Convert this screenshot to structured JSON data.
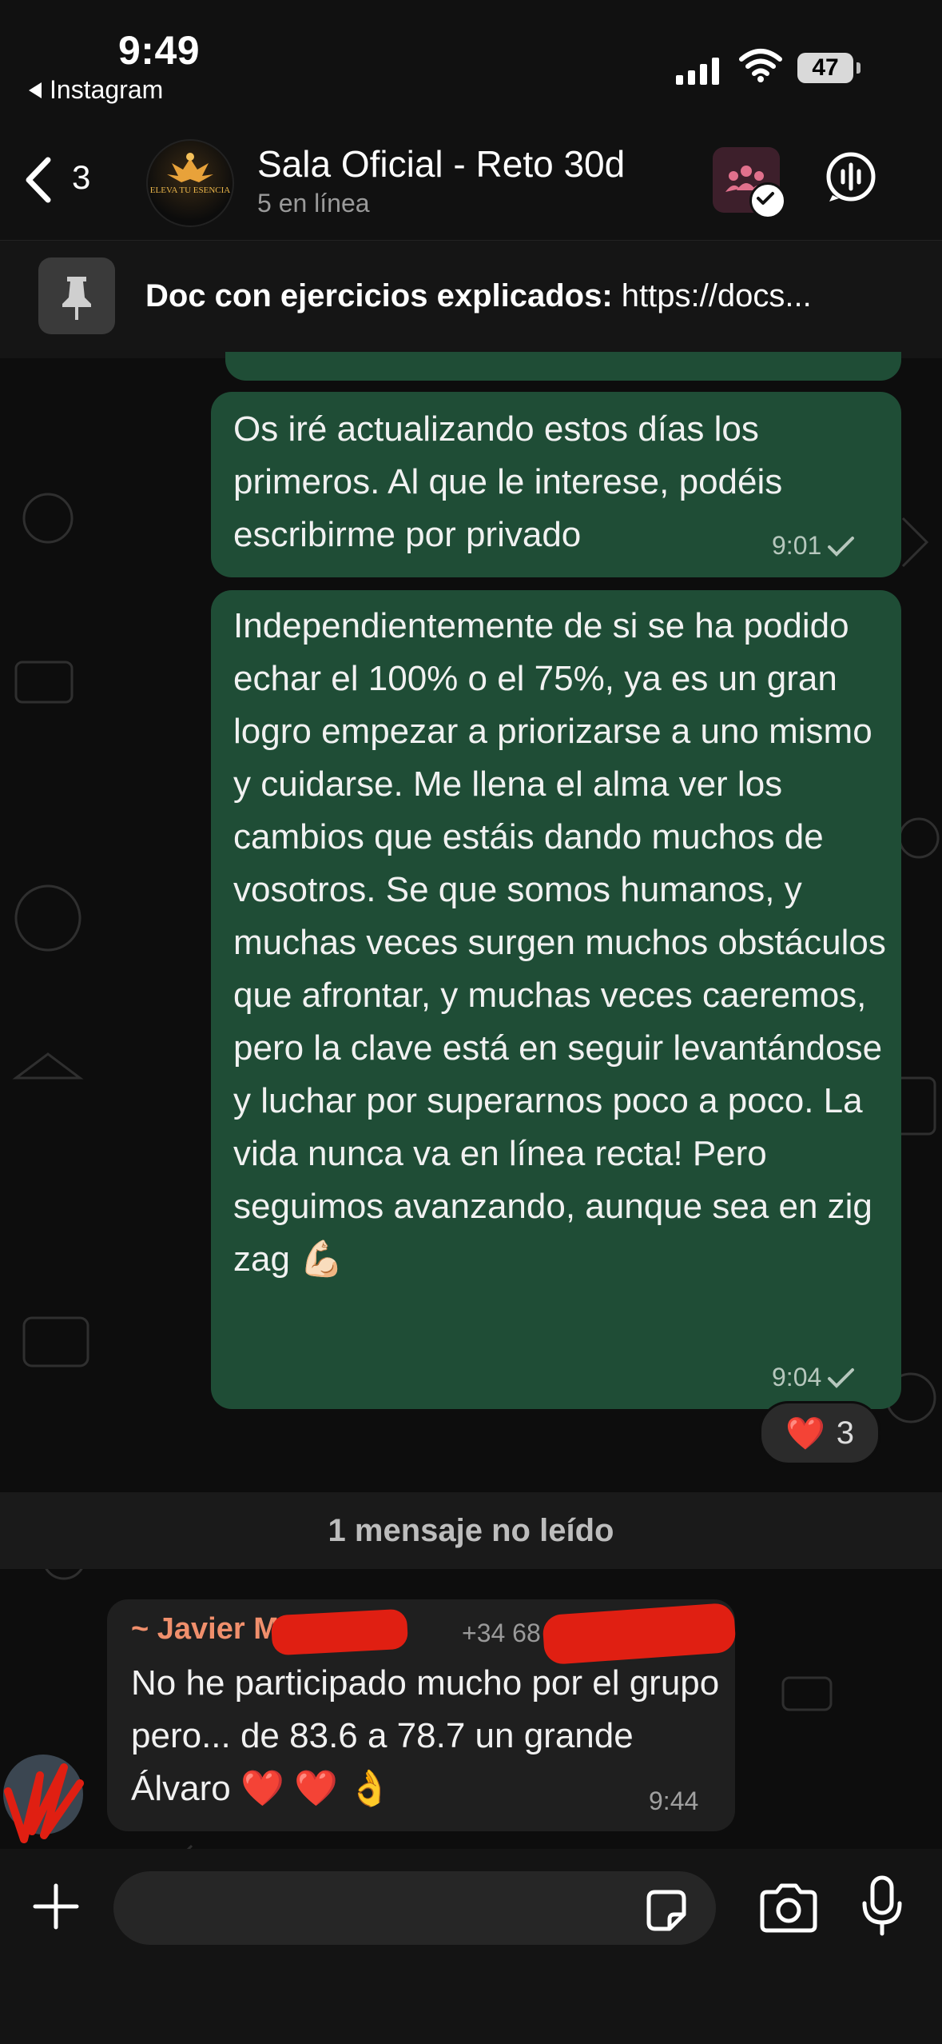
{
  "status_bar": {
    "time": "9:49",
    "back_app": "Instagram",
    "battery": "47"
  },
  "header": {
    "back_count": "3",
    "avatar_text": "ELEVA TU ESENCIA",
    "title": "Sala Oficial - Reto 30d",
    "subtitle": "5 en línea",
    "accent_color": "#3d1f2b"
  },
  "pinned": {
    "label": "Doc con ejercicios explicados:",
    "link": "https://docs..."
  },
  "messages": {
    "m1": {
      "text": "Os iré actualizando estos días los primeros. Al que le interese, podéis escribirme por privado",
      "time": "9:01"
    },
    "m2": {
      "text": "Independientemente de si se ha podido echar el 100% o el 75%, ya es un gran logro empezar a priorizarse a uno mismo y cuidarse. Me llena el alma ver los cambios que estáis dando muchos de vosotros. Se que somos humanos, y muchas veces surgen muchos obstáculos que afrontar, y muchas veces caeremos, pero la clave está en seguir levantándose y luchar por superarnos poco a poco. La vida nunca va en línea recta! Pero seguimos avanzando, aunque sea en zig zag 💪🏻",
      "time": "9:04",
      "reaction_emoji": "❤️",
      "reaction_count": "3"
    },
    "unread": "1 mensaje no leído",
    "m3": {
      "sender": "~ Javier M",
      "phone": "+34 68",
      "text": "No he participado mucho por el grupo pero... de  83.6 a 78.7 un grande Álvaro ❤️ ❤️ 👌",
      "time": "9:44"
    }
  },
  "colors": {
    "outgoing_bubble": "#1f4d36",
    "incoming_bubble": "#1f1f1f",
    "sender_name": "#f08f6c"
  }
}
